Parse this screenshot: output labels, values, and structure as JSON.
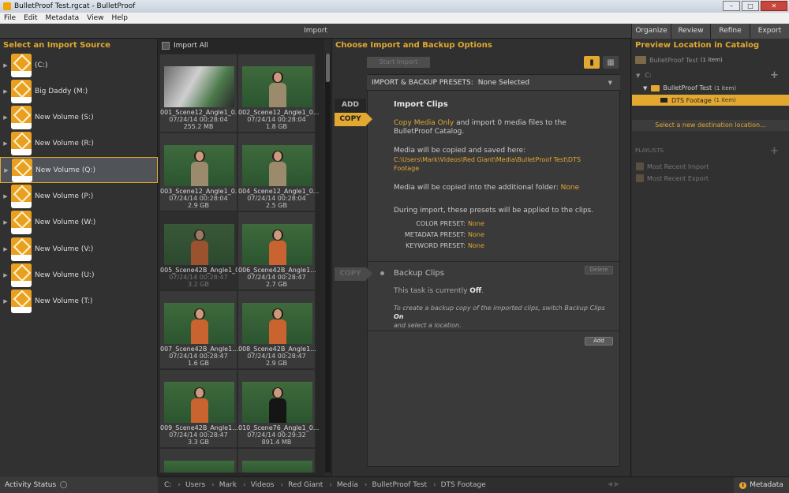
{
  "window": {
    "title": "BulletProof Test.rgcat - BulletProof",
    "minimize": "–",
    "maximize": "□",
    "close": "✕"
  },
  "menu": [
    "File",
    "Edit",
    "Metadata",
    "View",
    "Help"
  ],
  "modes": {
    "current": "Import",
    "tabs": [
      "Organize",
      "Review",
      "Refine",
      "Export"
    ]
  },
  "sources": {
    "heading": "Select an Import Source",
    "items": [
      "(C:)",
      "Big Daddy (M:)",
      "New Volume (S:)",
      "New Volume (R:)",
      "New Volume (Q:)",
      "New Volume (P:)",
      "New Volume (W:)",
      "New Volume (V:)",
      "New Volume (U:)",
      "New Volume (T:)"
    ],
    "selected_index": 4
  },
  "thumbs": {
    "import_all": "Import All",
    "items": [
      {
        "name": "001_Scene12_Angle1_0...",
        "date": "07/24/14 00:28:04",
        "size": "255.2 MB"
      },
      {
        "name": "002_Scene12_Angle1_0...",
        "date": "07/24/14 00:28:04",
        "size": "1.8 GB"
      },
      {
        "name": "003_Scene12_Angle1_0...",
        "date": "07/24/14 00:28:04",
        "size": "2.9 GB"
      },
      {
        "name": "004_Scene12_Angle1_0...",
        "date": "07/24/14 00:28:04",
        "size": "2.5 GB"
      },
      {
        "name": "005_Scene42B_Angle1_0...",
        "date": "07/24/14 00:28:47",
        "size": "3.2 GB"
      },
      {
        "name": "006_Scene42B_Angle1...",
        "date": "07/24/14 00:28:47",
        "size": "2.7 GB"
      },
      {
        "name": "007_Scene42B_Angle1...",
        "date": "07/24/14 00:28:47",
        "size": "1.6 GB"
      },
      {
        "name": "008_Scene42B_Angle1...",
        "date": "07/24/14 00:28:47",
        "size": "2.9 GB"
      },
      {
        "name": "009_Scene42B_Angle1...",
        "date": "07/24/14 00:28:47",
        "size": "3.3 GB"
      },
      {
        "name": "010_Scene76_Angle1_0...",
        "date": "07/24/14 00:29:32",
        "size": "891.4 MB"
      }
    ]
  },
  "options": {
    "heading": "Choose Import and Backup Options",
    "start_import": "Start Import",
    "presets_label": "IMPORT & BACKUP PRESETS:",
    "presets_value": "None Selected",
    "add_label": "ADD",
    "copy_label": "COPY",
    "import_clips": {
      "title": "Import Clips",
      "copy_mode": "Copy Media Only",
      "line1_rest": " and import 0 media files to the BulletProof Catalog.",
      "saved_here": "Media will be copied and saved here:",
      "path": "C:\\Users\\Mark\\Videos\\Red Giant\\Media\\BulletProof Test\\DTS Footage",
      "additional": "Media will be copied into the additional folder: ",
      "additional_value": "None",
      "presets_applied": "During import, these presets will be applied to the clips.",
      "color_label": "COLOR PRESET:",
      "color_value": "None",
      "metadata_label": "METADATA PRESET:",
      "metadata_value": "None",
      "keyword_label": "KEYWORD PRESET:",
      "keyword_value": "None"
    },
    "backup": {
      "copy_label": "COPY",
      "title": "Backup Clips",
      "delete": "Delete",
      "state_prefix": "This task is currently ",
      "state": "Off",
      "state_suffix": ".",
      "hint1": "To create a backup copy of the imported clips, switch Backup Clips ",
      "hint_on": "On",
      "hint2": "and select a location.",
      "add": "Add"
    }
  },
  "preview": {
    "heading": "Preview Location in Catalog",
    "library": "BulletProof Test",
    "library_count": "(1 item)",
    "drive": "C:",
    "folder": "BulletProof Test",
    "folder_count": "(1 item)",
    "subfolder": "DTS Footage",
    "subfolder_count": "(1 item)",
    "destination": "Select a new destination location...",
    "playlists_heading": "PLAYLISTS",
    "playlists": [
      "Most Recent Import",
      "Most Recent Export"
    ]
  },
  "status": {
    "activity": "Activity Status",
    "crumbs": [
      "C:",
      "Users",
      "Mark",
      "Videos",
      "Red Giant",
      "Media",
      "BulletProof Test",
      "DTS Footage"
    ],
    "metadata": "Metadata"
  },
  "colors": {
    "accent": "#e2a830",
    "panel": "#313131",
    "background": "#2b2b2b"
  }
}
